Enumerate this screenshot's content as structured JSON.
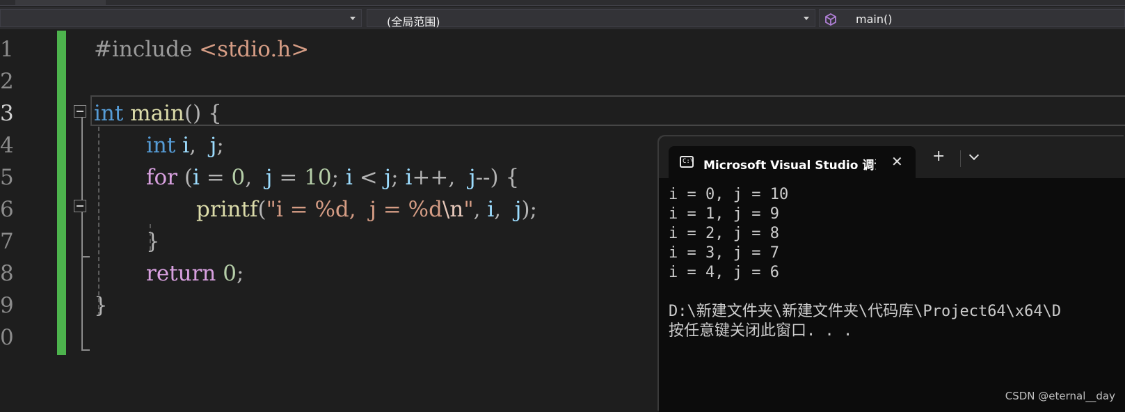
{
  "nav": {
    "scope_label": "(全局范围)",
    "member_label": "main()"
  },
  "editor": {
    "line_numbers": [
      "1",
      "2",
      "3",
      "4",
      "5",
      "6",
      "7",
      "8",
      "9",
      "0"
    ],
    "lines": {
      "l1_directive": "#include",
      "l1_header": "<stdio.h>",
      "l3_type": "int",
      "l3_fn": "main",
      "l3_rest": "() {",
      "l4_type": "int",
      "l4_i": "i",
      "l4_comma": ",",
      "l4_j": "j",
      "l4_semi": ";",
      "l5_for": "for",
      "l5_open": "(",
      "l5_i1": "i",
      "l5_eq1": " = ",
      "l5_zero": "0",
      "l5_c1": ",",
      "l5_j1": "j",
      "l5_eq2": " = ",
      "l5_ten": "10",
      "l5_s1": ";",
      "l5_i2": "i",
      "l5_lt": " < ",
      "l5_j2": "j",
      "l5_s2": ";",
      "l5_i3": "i",
      "l5_inc": "++",
      "l5_c2": ",",
      "l5_j3": "j",
      "l5_dec": "--",
      "l5_close": ") {",
      "l6_fn": "printf",
      "l6_open": "(",
      "l6_str1": "\"i = %d,  j = %d",
      "l6_esc": "\\n",
      "l6_str2": "\"",
      "l6_c1": ",",
      "l6_i": "i",
      "l6_c2": ",",
      "l6_j": "j",
      "l6_close": ");",
      "l7_brace": "}",
      "l8_ret": "return",
      "l8_zero": "0",
      "l8_semi": ";",
      "l9_brace": "}"
    }
  },
  "console": {
    "tab_title": "Microsoft Visual Studio 调试控制台",
    "close_glyph": "✕",
    "new_tab_glyph": "+",
    "output": [
      "i = 0, j = 10",
      "i = 1, j = 9",
      "i = 2, j = 8",
      "i = 3, j = 7",
      "i = 4, j = 6",
      "",
      "D:\\新建文件夹\\新建文件夹\\代码库\\Project64\\x64\\D",
      "按任意键关闭此窗口. . ."
    ],
    "watermark": "CSDN @eternal__day"
  }
}
